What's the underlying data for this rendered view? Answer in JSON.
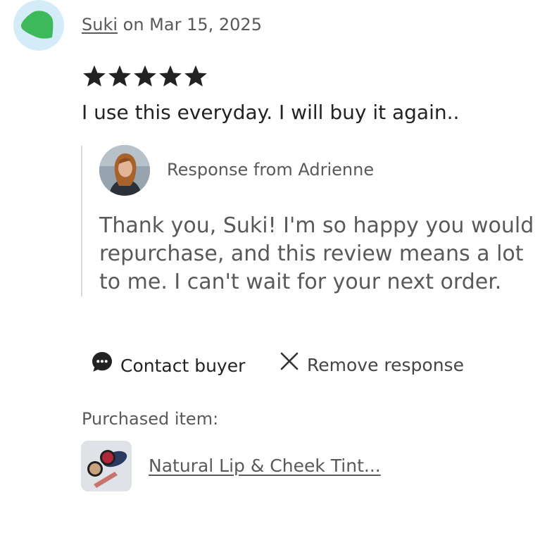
{
  "review": {
    "reviewer_name": "Suki",
    "date_text": "on Mar 15, 2025",
    "rating": 5,
    "rating_max": 5,
    "text": "I use this everyday. I will buy it again..",
    "reviewer_avatar_icon": "green-leaf-avatar"
  },
  "response": {
    "label": "Response from Adrienne",
    "lines": [
      "Thank you, Suki! I'm so happy you would",
      "repurchase, and this review means a lot",
      "to me. I can't wait for your next order."
    ]
  },
  "actions": {
    "contact_label": "Contact buyer",
    "contact_icon": "chat-bubble-icon",
    "remove_label": "Remove response",
    "remove_icon": "close-icon"
  },
  "purchase": {
    "label": "Purchased item:",
    "item_title": "Natural Lip & Cheek Tint..."
  },
  "colors": {
    "star": "#222222",
    "avatar_bg": "#d4ebf8",
    "avatar_leaf": "#3cb95a",
    "muted_text": "#595959"
  }
}
